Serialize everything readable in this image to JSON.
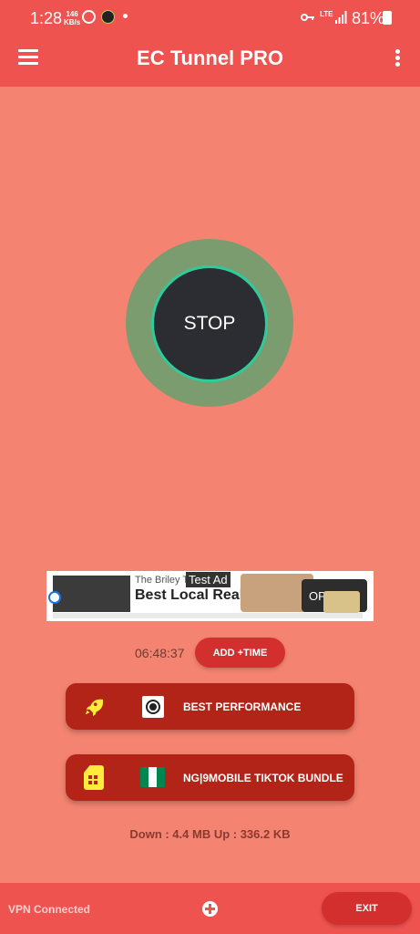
{
  "status_bar": {
    "time": "1:28",
    "speed_value": "146",
    "speed_unit": "KB/s",
    "network": "LTE",
    "battery": "81%"
  },
  "app_bar": {
    "title": "EC Tunnel PRO"
  },
  "connect_button": {
    "label": "STOP"
  },
  "ad": {
    "tag": "Test Ad",
    "advertiser": "The Briley T",
    "headline": "Best Local Real Esta Agents",
    "cta": "OP"
  },
  "session": {
    "timer": "06:48:37",
    "add_time_label": "ADD +TIME"
  },
  "server": {
    "label": "BEST PERFORMANCE",
    "icon": "target-icon"
  },
  "network_profile": {
    "label": "NG|9MOBILE TIKTOK BUNDLE",
    "flag_colors": [
      "#008751",
      "#ffffff",
      "#008751"
    ]
  },
  "traffic": {
    "text": "Down : 4.4 MB   Up : 336.2 KB"
  },
  "bottom_bar": {
    "status": "VPN Connected",
    "exit_label": "EXIT"
  },
  "colors": {
    "background": "#f48471",
    "appbar": "#ef5350",
    "card": "#b22418",
    "accent_ring": "#2ecc9a"
  }
}
